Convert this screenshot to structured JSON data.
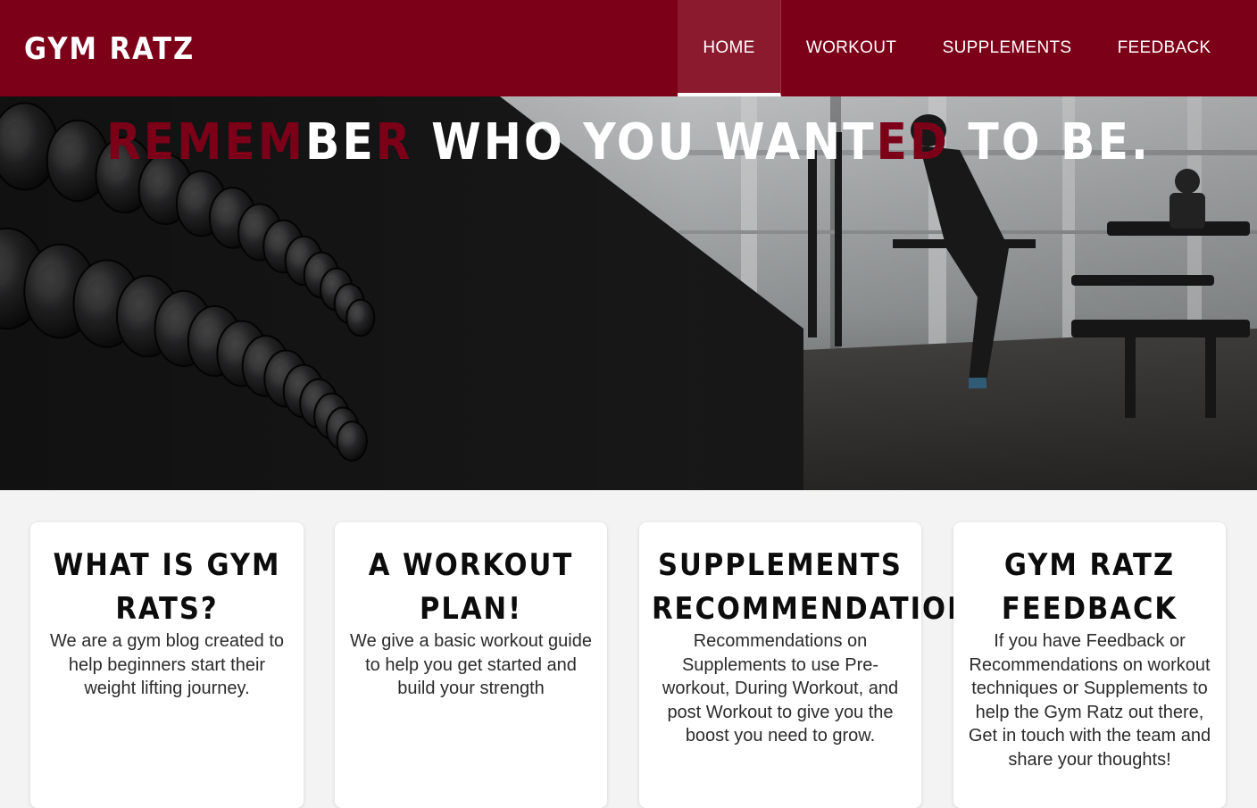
{
  "brand": {
    "name": "GYM RATZ"
  },
  "nav": {
    "items": [
      {
        "label": "HOME",
        "active": true
      },
      {
        "label": "WORKOUT",
        "active": false
      },
      {
        "label": "SUPPLEMENTS",
        "active": false
      },
      {
        "label": "FEEDBACK",
        "active": false
      }
    ]
  },
  "hero": {
    "headline_parts": [
      {
        "text": "REMEM",
        "accent": true
      },
      {
        "text": "BE",
        "accent": false
      },
      {
        "text": "R",
        "accent": true
      },
      {
        "text": " WHO YOU WANT",
        "accent": false
      },
      {
        "text": "ED",
        "accent": true
      },
      {
        "text": " TO BE.",
        "accent": false
      }
    ]
  },
  "cards": [
    {
      "title": "WHAT IS GYM RATS?",
      "text": "We are a gym blog created to help beginners start their weight lifting journey."
    },
    {
      "title": "A WORKOUT PLAN!",
      "text": "We give a basic workout guide to help you get started and build your strength"
    },
    {
      "title": "SUPPLEMENTS RECOMMENDATION",
      "text": "Recommendations on Supplements to use Pre-workout, During Workout, and post Workout to give you the boost you need to grow."
    },
    {
      "title": "GYM RATZ FEEDBACK",
      "text": "If you have Feedback or Recommendations on workout techniques or Supplements to help the Gym Ratz out there, Get in touch with the team and share your thoughts!"
    }
  ],
  "colors": {
    "brand": "#7d0019",
    "nav_active": "#8c1a2f",
    "card_bg": "#ffffff",
    "page_bg": "#f2f3f2"
  },
  "icons": {
    "hero_image": "gym-dumbbell-rack-photo"
  }
}
